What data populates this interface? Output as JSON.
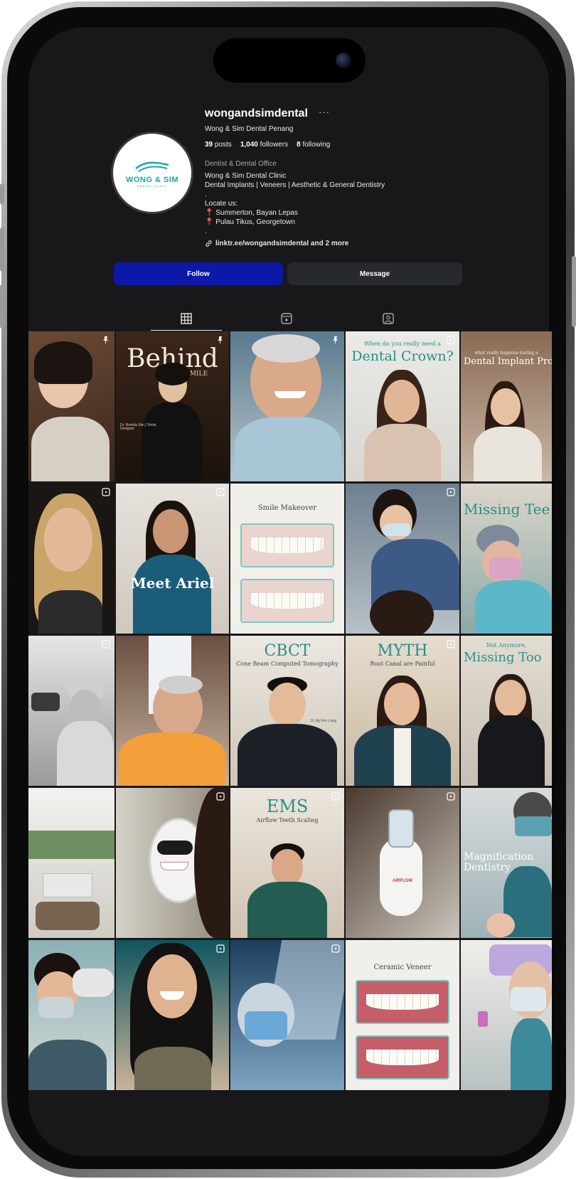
{
  "profile": {
    "username": "wongandsimdental",
    "more": "···",
    "full_name": "Wong & Sim Dental Penang",
    "stats": [
      {
        "count": "39",
        "label": "posts"
      },
      {
        "count": "1,040",
        "label": "followers"
      },
      {
        "count": "8",
        "label": "following"
      }
    ],
    "category": "Dentist & Dental Office",
    "bio_lines": [
      "Wong & Sim Dental Clinic",
      "Dental Implants | Veneers | Aesthetic & General Dentistry",
      ".",
      "Locate us:"
    ],
    "locations": [
      "Summerton, Bayan Lepas",
      "Pulau Tikus, Georgetown"
    ],
    "bio_end": ".",
    "link": "linktr.ee/wongandsimdental and 2 more",
    "avatar_brand": "WONG & SIM",
    "avatar_sub": "DENTAL CLINIC"
  },
  "actions": {
    "follow": "Follow",
    "message": "Message"
  },
  "tabs": [
    {
      "icon": "grid-icon"
    },
    {
      "icon": "reels-icon"
    },
    {
      "icon": "tagged-icon"
    }
  ],
  "posts": [
    {
      "caption": ""
    },
    {
      "caption": "Behind",
      "caption2": "the SMILE",
      "small": "Dr. Brenda Sim | Smile Designer"
    },
    {
      "caption": ""
    },
    {
      "caption": "Dental Crown?",
      "caption2": "When do you really need a"
    },
    {
      "caption": "Dental Implant Proced",
      "caption2": "what really happens during a"
    },
    {
      "caption": ""
    },
    {
      "caption": "Meet Ariel"
    },
    {
      "caption": "Smile Makeover"
    },
    {
      "caption": ""
    },
    {
      "caption": "Missing Tee"
    },
    {
      "caption": ""
    },
    {
      "caption": ""
    },
    {
      "caption": "CBCT",
      "caption2": "Cone Beam Computed Tomography",
      "small": "Dr Ng Wei Liang"
    },
    {
      "caption": "MYTH",
      "caption2": "Root Canal are Painful"
    },
    {
      "caption": "Missing Too",
      "caption2": "Not Anymore,"
    },
    {
      "caption": ""
    },
    {
      "caption": ""
    },
    {
      "caption": "EMS",
      "caption2": "Airflow Teeth Scaling"
    },
    {
      "caption": "AIRFLOW"
    },
    {
      "caption": "Magnification Dentistry"
    },
    {
      "caption": ""
    },
    {
      "caption": ""
    },
    {
      "caption": ""
    },
    {
      "caption": "Ceramic Veneer"
    },
    {
      "caption": ""
    }
  ]
}
